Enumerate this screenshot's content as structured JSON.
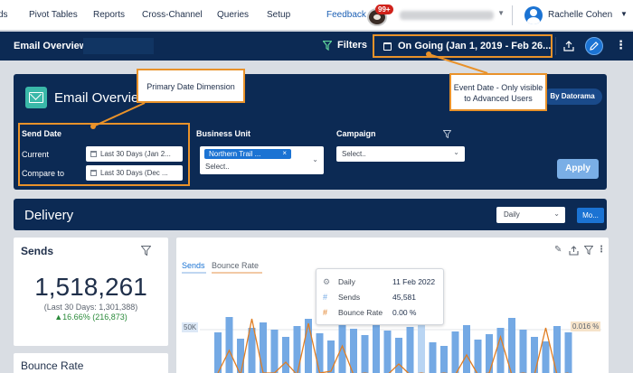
{
  "topnav": {
    "items": [
      "ds",
      "Pivot Tables",
      "Reports",
      "Cross-Channel",
      "Queries",
      "Setup"
    ],
    "feedback": "Feedback",
    "notification_count": "99+",
    "user_name": "Rachelle Cohen"
  },
  "dashboard": {
    "title": "Email Overview",
    "filters_label": "Filters",
    "date_range": "On Going (Jan 1, 2019 - Feb 26..."
  },
  "panel": {
    "title": "Email Overvie",
    "by_datorama": "By Datorama",
    "send_date": {
      "label": "Send Date",
      "current_label": "Current",
      "current_value": "Last 30 Days (Jan 2...",
      "compare_label": "Compare to",
      "compare_value": "Last 30 Days (Dec ..."
    },
    "business_unit": {
      "label": "Business Unit",
      "selected": "Northern Trail ...",
      "remove": "×",
      "placeholder": "Select.."
    },
    "campaign": {
      "label": "Campaign",
      "placeholder": "Select.."
    },
    "apply_label": "Apply"
  },
  "delivery": {
    "title": "Delivery",
    "granularity": "Daily",
    "more_label": "Mo..."
  },
  "sends_card": {
    "title": "Sends",
    "value": "1,518,261",
    "compare": "(Last 30 Days: 1,301,388)",
    "change": "▲16.66% (216,873)"
  },
  "bounce_card": {
    "title": "Bounce Rate"
  },
  "chart": {
    "tabs": [
      "Sends",
      "Bounce Rate"
    ],
    "y_label": "50K",
    "right_label": "0.016 %",
    "colors": {
      "bars": "#74a9e4",
      "line": "#e07d22",
      "highlight": "#b9d5f3"
    },
    "tooltip": {
      "rows": [
        {
          "icon": "⚙",
          "key": "Daily",
          "value": "11 Feb 2022"
        },
        {
          "icon": "#",
          "key": "Sends",
          "value": "45,581"
        },
        {
          "icon": "#",
          "key": "Bounce Rate",
          "value": "0.00 %"
        }
      ]
    }
  },
  "callouts": {
    "primary": "Primary Date Dimension",
    "event": "Event Date - Only visible to Advanced Users"
  }
}
